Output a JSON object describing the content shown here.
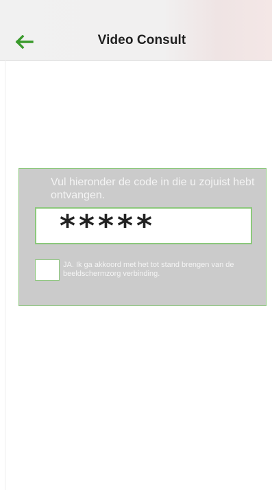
{
  "header": {
    "title": "Video Consult",
    "back_icon": "arrow-left-icon",
    "accent_color": "#3a9a2c"
  },
  "code_panel": {
    "instruction": "Vul hieronder de code in die u zojuist hebt ontvangen.",
    "code_value": "*****",
    "consent_label": "JA. Ik ga akkoord met het tot stand brengen van de beeldschermzorg verbinding.",
    "consent_checked": false,
    "border_color": "#8cc87c",
    "background_color": "#cbcbcb"
  }
}
